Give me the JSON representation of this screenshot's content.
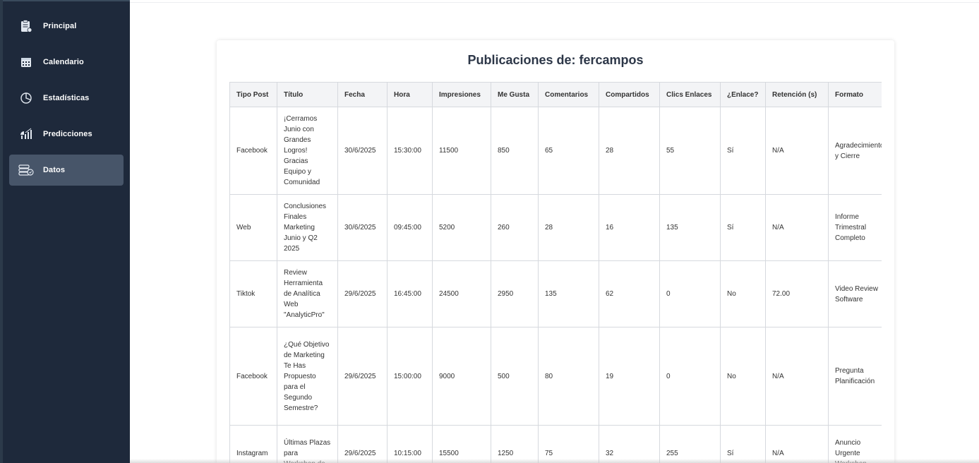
{
  "sidebar": {
    "items": [
      {
        "label": "Principal",
        "icon": "clipboard-icon",
        "active": false
      },
      {
        "label": "Calendario",
        "icon": "calendar-icon",
        "active": false
      },
      {
        "label": "Estadísticas",
        "icon": "pie-chart-icon",
        "active": false
      },
      {
        "label": "Predicciones",
        "icon": "bar-chart-icon",
        "active": false
      },
      {
        "label": "Datos",
        "icon": "database-icon",
        "active": true
      }
    ]
  },
  "main": {
    "title": "Publicaciones de: fercampos",
    "table": {
      "headers": [
        "Tipo Post",
        "Título",
        "Fecha",
        "Hora",
        "Impresiones",
        "Me Gusta",
        "Comentarios",
        "Compartidos",
        "Clics Enlaces",
        "¿Enlace?",
        "Retención (s)",
        "Formato"
      ],
      "rows": [
        [
          "Facebook",
          "¡Cerramos Junio con Grandes Logros! Gracias Equipo y Comunidad",
          "30/6/2025",
          "15:30:00",
          "11500",
          "850",
          "65",
          "28",
          "55",
          "Sí",
          "N/A",
          "Agradecimiento y Cierre"
        ],
        [
          "Web",
          "Conclusiones Finales Marketing Junio y Q2 2025",
          "30/6/2025",
          "09:45:00",
          "5200",
          "260",
          "28",
          "16",
          "135",
          "Sí",
          "N/A",
          "Informe Trimestral Completo"
        ],
        [
          "Tiktok",
          "Review Herramienta de Analítica Web \"AnalyticPro\"",
          "29/6/2025",
          "16:45:00",
          "24500",
          "2950",
          "135",
          "62",
          "0",
          "No",
          "72.00",
          "Video Review Software"
        ],
        [
          "Facebook",
          "¿Qué Objetivo de Marketing Te Has Propuesto para el Segundo Semestre?",
          "29/6/2025",
          "15:00:00",
          "9000",
          "500",
          "80",
          "19",
          "0",
          "No",
          "N/A",
          "Pregunta Planificación"
        ],
        [
          "Instagram",
          "Últimas Plazas para Workshop de",
          "29/6/2025",
          "10:15:00",
          "15500",
          "1250",
          "75",
          "32",
          "255",
          "Sí",
          "N/A",
          "Anuncio Urgente Workshop"
        ]
      ]
    }
  }
}
